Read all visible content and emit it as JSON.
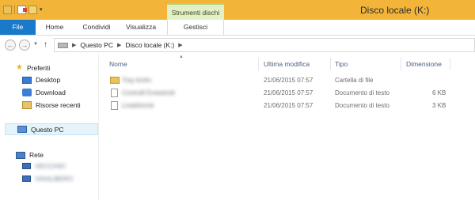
{
  "window": {
    "title": "Disco locale (K:)",
    "accent": "#f2b53a",
    "file_tab_color": "#1979ca"
  },
  "ribbon": {
    "context_group": "Strumenti dischi",
    "tabs": {
      "file": "File",
      "home": "Home",
      "share": "Condividi",
      "view": "Visualizza",
      "manage": "Gestisci"
    }
  },
  "address": {
    "segments": [
      "Questo PC",
      "Disco locale (K:)"
    ]
  },
  "sidebar": {
    "favorites": {
      "label": "Preferiti",
      "items": [
        "Desktop",
        "Download",
        "Risorse recenti"
      ]
    },
    "this_pc": "Questo PC",
    "network": {
      "label": "Rete",
      "hosts": [
        "VECCHIO",
        "VIAALBERO"
      ]
    }
  },
  "columns": {
    "name": "Nome",
    "modified": "Ultima modifica",
    "type": "Tipo",
    "size": "Dimensione"
  },
  "files": [
    {
      "name": "Tray kmlm",
      "modified": "21/06/2015 07:57",
      "type": "Cartella di file",
      "size": "",
      "kind": "folder"
    },
    {
      "name": "Controlli Ereasinoli",
      "modified": "21/06/2015 07:57",
      "type": "Documento di testo",
      "size": "6 KB",
      "kind": "text"
    },
    {
      "name": "Lmaitnicmk",
      "modified": "21/06/2015 07:57",
      "type": "Documento di testo",
      "size": "3 KB",
      "kind": "text"
    }
  ]
}
